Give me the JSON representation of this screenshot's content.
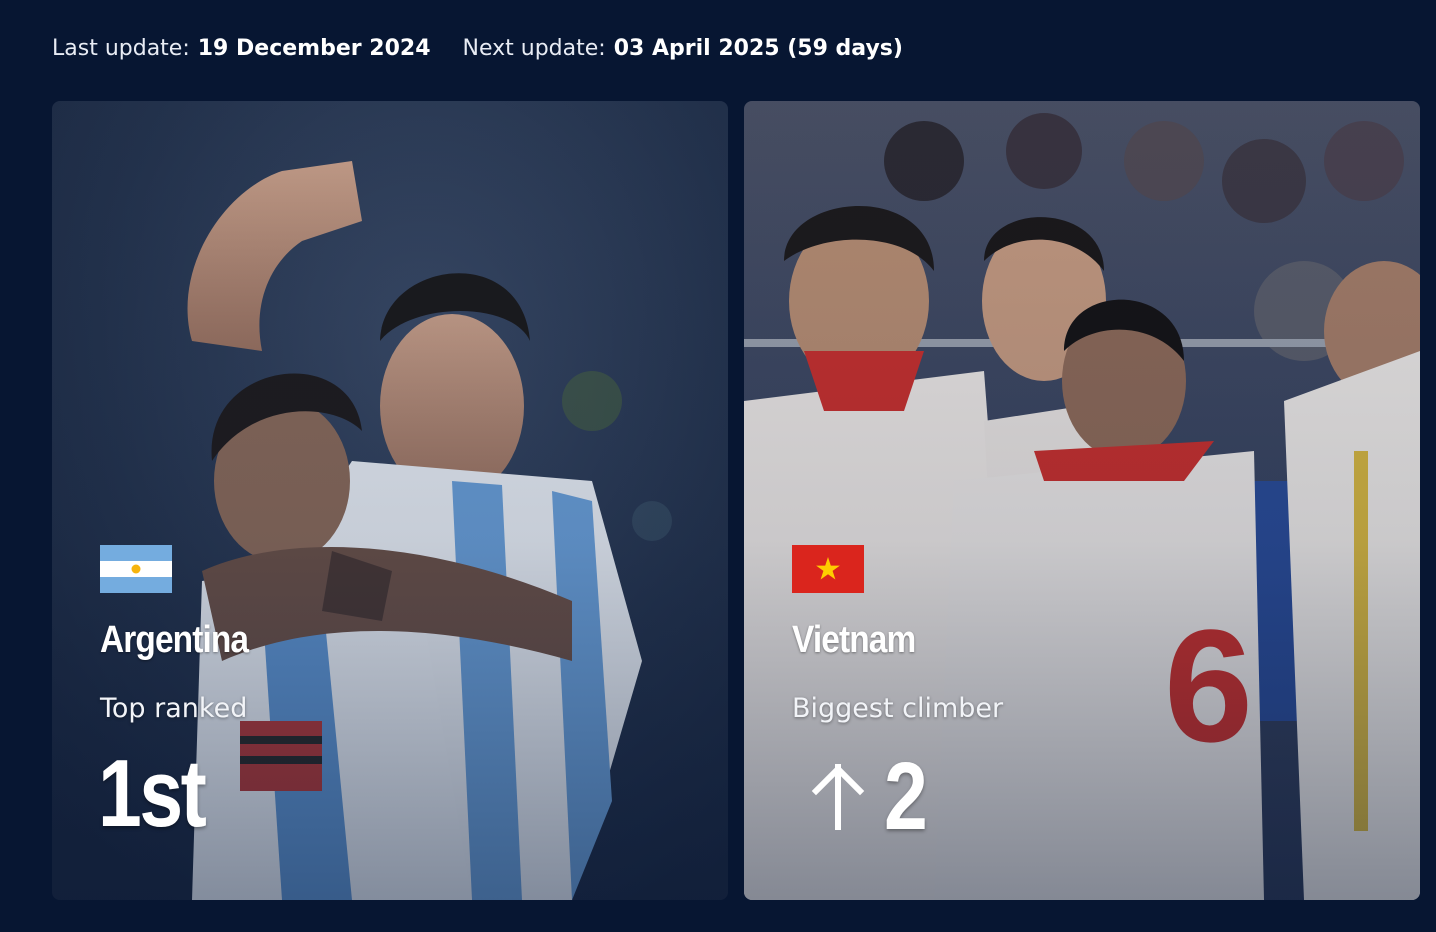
{
  "updates": {
    "last_label": "Last update:",
    "last_value": "19 December 2024",
    "next_label": "Next update:",
    "next_value": "03 April 2025 (59 days)"
  },
  "cards": [
    {
      "country": "Argentina",
      "subtitle": "Top ranked",
      "value": "1st",
      "flag_icon": "argentina-flag-icon",
      "image": "argentina-players-celebrating-photo"
    },
    {
      "country": "Vietnam",
      "subtitle": "Biggest climber",
      "value": "2",
      "trend_icon": "arrow-up-icon",
      "flag_icon": "vietnam-flag-icon",
      "image": "vietnam-players-celebrating-photo"
    }
  ],
  "colors": {
    "page_background": "#071632",
    "text": "#ffffff",
    "argentina_blue": "#74acdf",
    "vietnam_red": "#da251d",
    "vietnam_star": "#ffcd00"
  }
}
